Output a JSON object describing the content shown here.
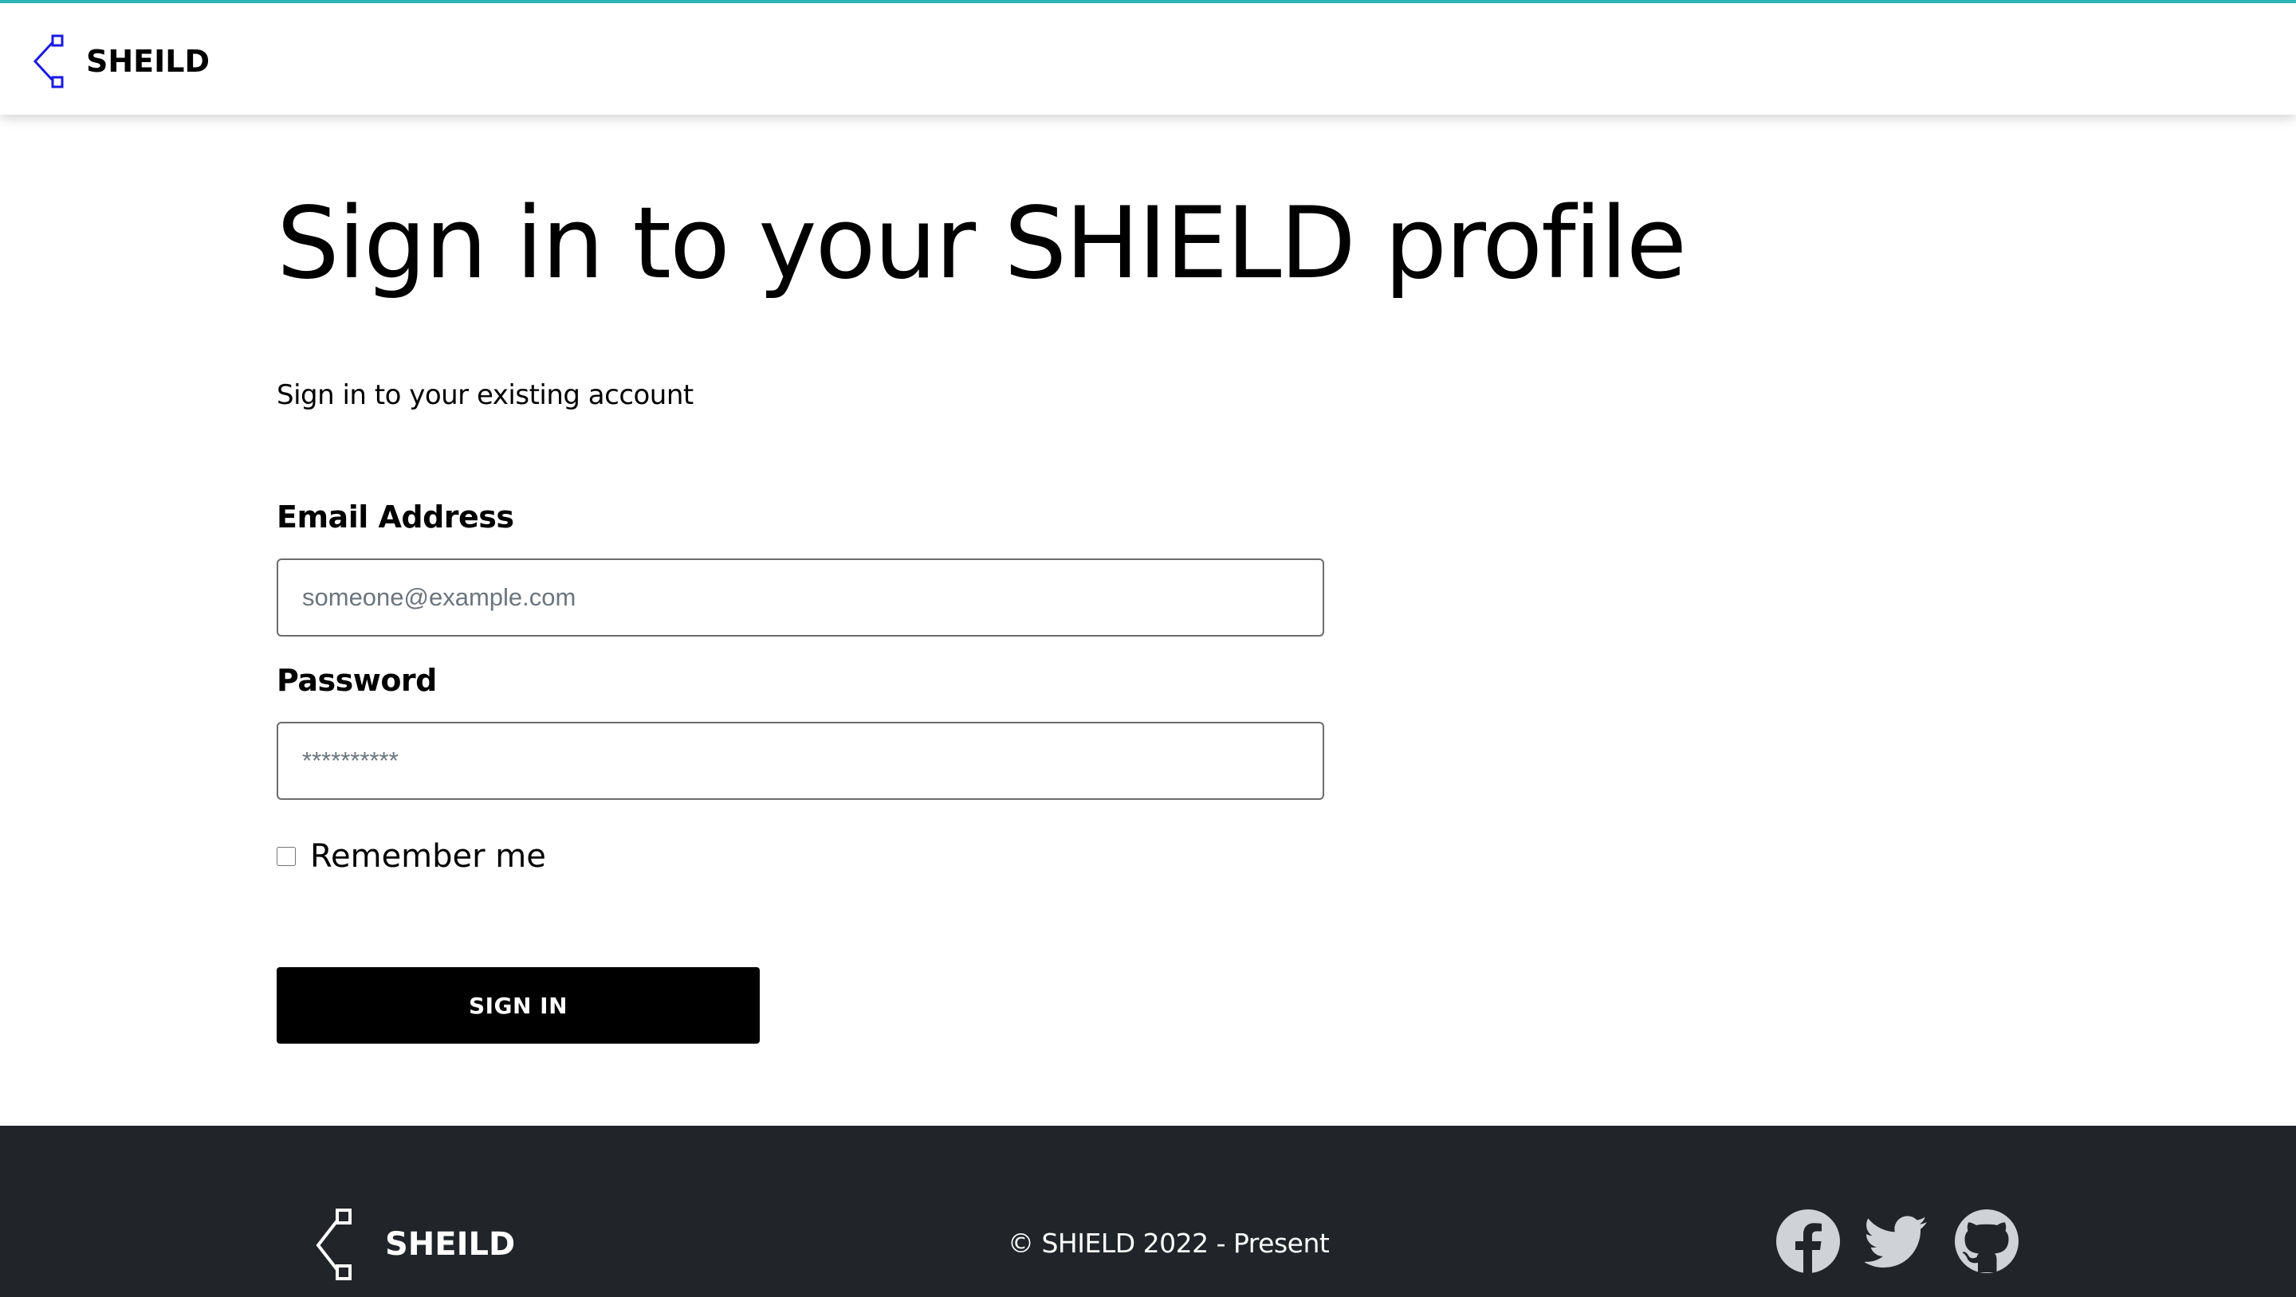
{
  "header": {
    "brand": "SHEILD",
    "logo_icon": "chevron-node-logo-icon",
    "logo_color": "#1a1ae6",
    "accent_line_color": "#2ab3b0"
  },
  "main": {
    "title": "Sign in to your SHIELD profile",
    "subtitle": "Sign in to your existing account",
    "email": {
      "label": "Email Address",
      "placeholder": "someone@example.com",
      "value": ""
    },
    "password": {
      "label": "Password",
      "placeholder": "**********",
      "value": ""
    },
    "remember": {
      "label": "Remember me",
      "checked": false
    },
    "submit_label": "SIGN IN"
  },
  "footer": {
    "brand": "SHEILD",
    "logo_icon": "chevron-node-logo-icon",
    "copyright": "© SHIELD 2022 - Present",
    "background": "#212529",
    "social": [
      {
        "name": "facebook-icon"
      },
      {
        "name": "twitter-icon"
      },
      {
        "name": "github-icon"
      }
    ],
    "social_icon_color": "#cfd2d6"
  }
}
